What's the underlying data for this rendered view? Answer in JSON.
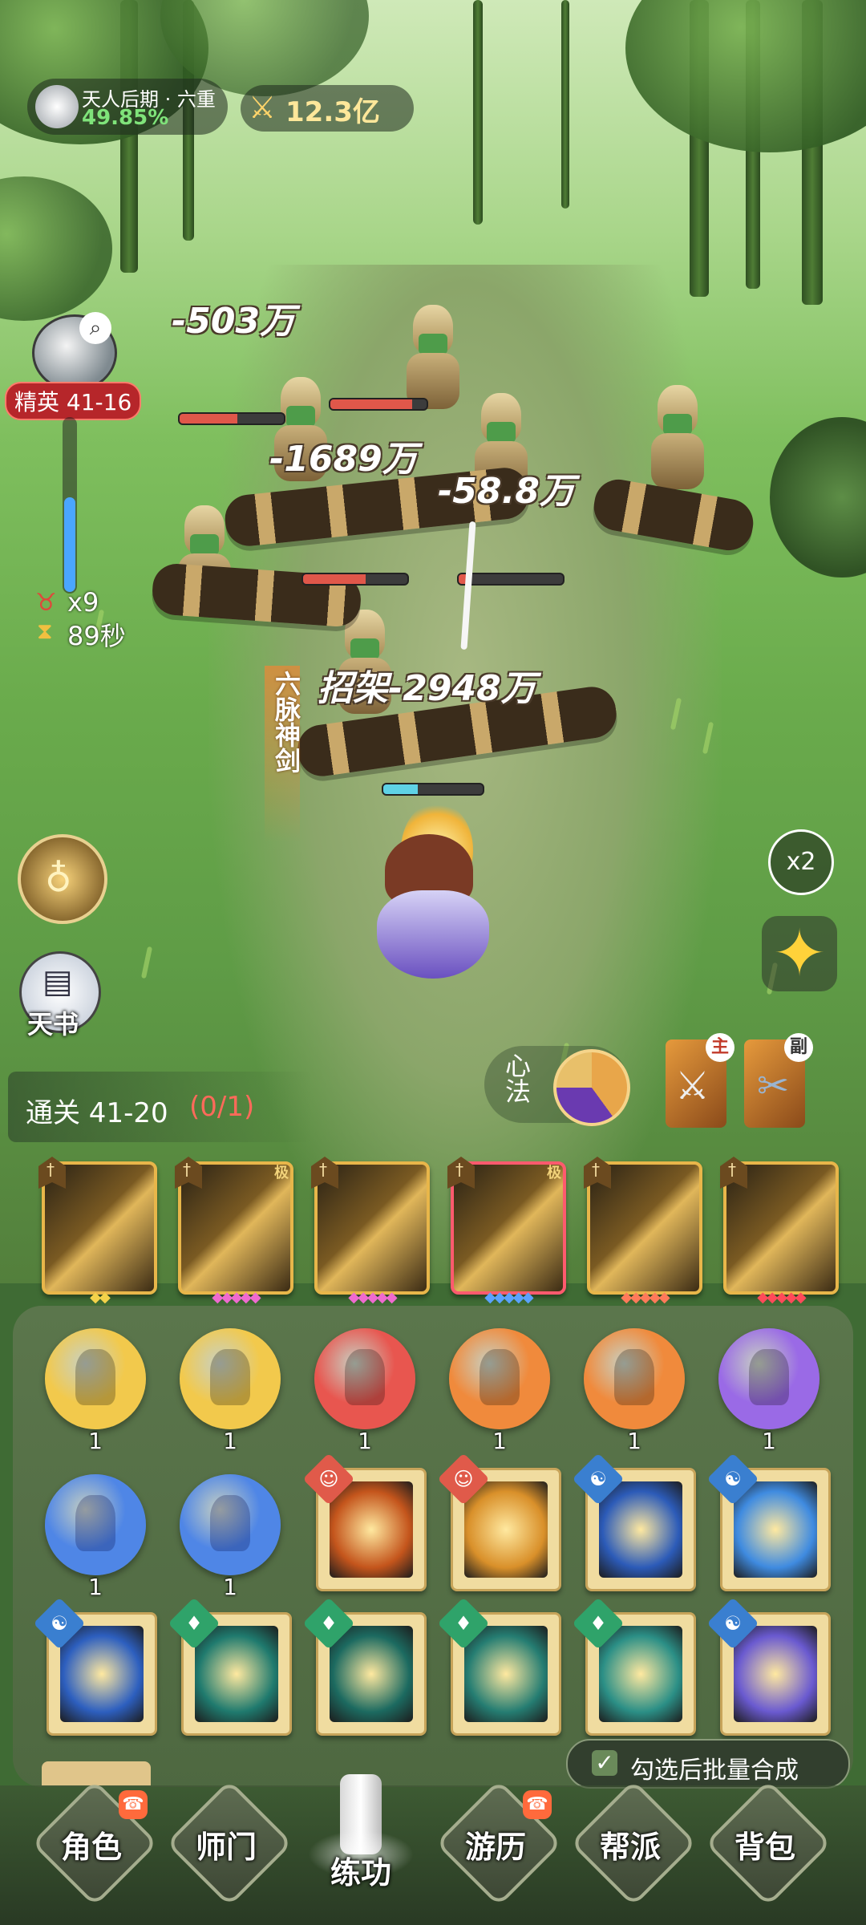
{
  "hud": {
    "realm_title": "天人后期 · 六重",
    "realm_progress": "49.85%",
    "combat_power": "12.3亿"
  },
  "stage": {
    "name": "精英 41-16",
    "enemy_multiplier": "x9",
    "timer": "89秒"
  },
  "damage_numbers": [
    "-503万",
    "-1689万",
    "-58.8万",
    "招架-2948万"
  ],
  "skill_banner": "六脉神剑",
  "side_buttons": {
    "speed": "x2",
    "tianshu": "天书"
  },
  "quest": {
    "label": "通关 41-20",
    "progress": "(0/1)"
  },
  "xinfa_label": "心法",
  "weapons": {
    "main_tag": "主",
    "sub_tag": "副"
  },
  "skill_cards": [
    {
      "icon": "sword-icon",
      "grade": "",
      "diamonds": "◆◆",
      "diamond_color": "#f3d24a",
      "border": "#e8b64a"
    },
    {
      "icon": "sword-icon",
      "grade": "极",
      "diamonds": "◆◆◆◆◆",
      "diamond_color": "#ef6ad0",
      "border": "#e8b64a"
    },
    {
      "icon": "sword-icon",
      "grade": "",
      "diamonds": "◆◆◆◆◆",
      "diamond_color": "#ef6ad0",
      "border": "#e8b64a"
    },
    {
      "icon": "sword-icon",
      "grade": "极",
      "diamonds": "◆◆◆◆◆",
      "diamond_color": "#5aa2ff",
      "border": "#ff5a6e"
    },
    {
      "icon": "sword-icon",
      "grade": "",
      "diamonds": "◆◆◆◆◆",
      "diamond_color": "#ff7a5a",
      "border": "#e8b64a"
    },
    {
      "icon": "sword-icon",
      "grade": "",
      "diamonds": "◆◆◆◆◆",
      "diamond_color": "#ff4a5a",
      "border": "#e8b64a"
    }
  ],
  "orbs_row1": [
    {
      "count": "1",
      "color": "#f2c94c"
    },
    {
      "count": "1",
      "color": "#f2c94c"
    },
    {
      "count": "1",
      "color": "#e8564f"
    },
    {
      "count": "1",
      "color": "#f08a3c"
    },
    {
      "count": "1",
      "color": "#f08a3c"
    },
    {
      "count": "1",
      "color": "#9a6ae6"
    }
  ],
  "orbs_row2": [
    {
      "count": "1",
      "color": "#4f86e6"
    },
    {
      "count": "1",
      "color": "#4f86e6"
    }
  ],
  "books_row2": [
    {
      "badge": "person-icon",
      "badge_color": "#e05a4a",
      "art": "#c4551c"
    },
    {
      "badge": "person-icon",
      "badge_color": "#e05a4a",
      "art": "#d9902a"
    },
    {
      "badge": "yinyang-icon",
      "badge_color": "#3a7fd0",
      "art": "#2c5bb8"
    },
    {
      "badge": "yinyang-icon",
      "badge_color": "#3a7fd0",
      "art": "#3f8be0"
    }
  ],
  "books_row3": [
    {
      "badge": "yinyang-icon",
      "badge_color": "#3a7fd0",
      "art": "#2d5fbf"
    },
    {
      "badge": "leaf-icon",
      "badge_color": "#2fa36a",
      "art": "#1f7a6e"
    },
    {
      "badge": "leaf-icon",
      "badge_color": "#2fa36a",
      "art": "#1c6a60"
    },
    {
      "badge": "leaf-icon",
      "badge_color": "#2fa36a",
      "art": "#257d72"
    },
    {
      "badge": "leaf-icon",
      "badge_color": "#2fa36a",
      "art": "#2b8f86"
    },
    {
      "badge": "yinyang-icon",
      "badge_color": "#3a7fd0",
      "art": "#6a5ad0"
    }
  ],
  "batch_merge": {
    "label": "勾选后批量合成",
    "checked": true
  },
  "nav": [
    {
      "label": "角色",
      "notif": true
    },
    {
      "label": "师门",
      "notif": false
    },
    {
      "label": "练功",
      "notif": false,
      "active": true
    },
    {
      "label": "游历",
      "notif": true
    },
    {
      "label": "帮派",
      "notif": false
    },
    {
      "label": "背包",
      "notif": false
    }
  ]
}
